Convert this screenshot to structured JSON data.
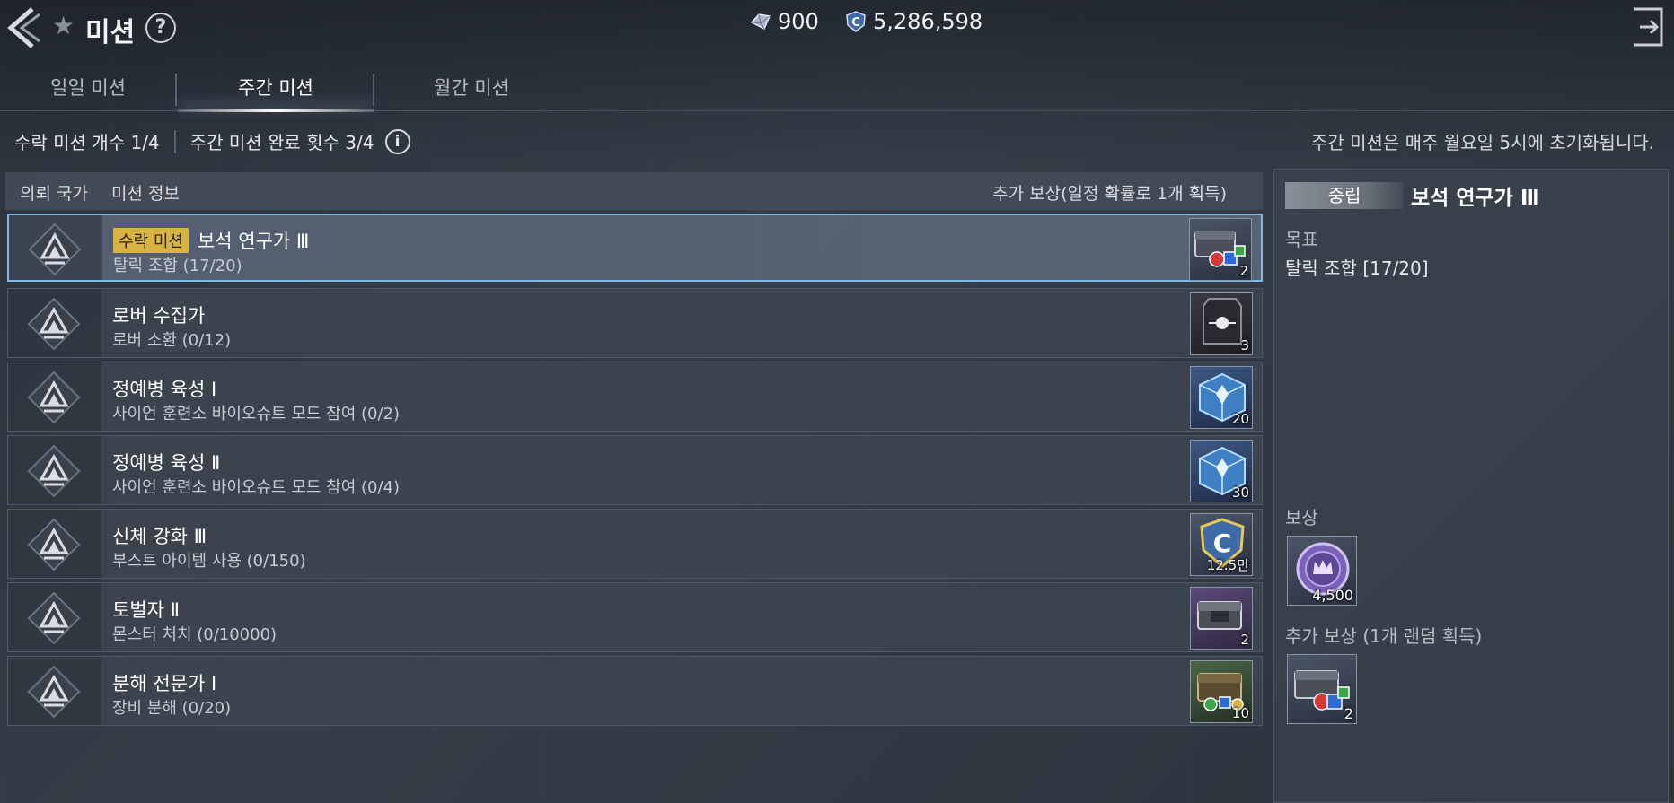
{
  "header": {
    "title": "미션",
    "help_label": "?",
    "gems": "900",
    "credits": "5,286,598"
  },
  "tabs": [
    {
      "label": "일일 미션",
      "active": false
    },
    {
      "label": "주간 미션",
      "active": true
    },
    {
      "label": "월간 미션",
      "active": false
    }
  ],
  "info": {
    "accepted_count": "수락 미션 개수 1/4",
    "weekly_completed": "주간 미션 완료 횟수 3/4",
    "info_icon": "i",
    "reset_note": "주간 미션은 매주 월요일 5시에 초기화됩니다."
  },
  "list_header": {
    "nation": "의뢰 국가",
    "mission_info": "미션 정보",
    "extra_reward": "추가 보상(일정 확률로 1개 획득)"
  },
  "missions": [
    {
      "tag": "수락 미션",
      "title": "보석 연구가 Ⅲ",
      "desc": "탈릭 조합 (17/20)",
      "reward_icon": "chest-gems-icon",
      "reward_count": "2",
      "selected": true
    },
    {
      "tag": "",
      "title": "로버 수집가",
      "desc": "로버 소환 (0/12)",
      "reward_icon": "rover-card-icon",
      "reward_count": "3",
      "selected": false
    },
    {
      "tag": "",
      "title": "정예병 육성 Ⅰ",
      "desc": "사이언 훈련소 바이오슈트 모드 참여 (0/2)",
      "reward_icon": "crystal-cube-icon",
      "reward_count": "20",
      "selected": false
    },
    {
      "tag": "",
      "title": "정예병 육성 Ⅱ",
      "desc": "사이언 훈련소 바이오슈트 모드 참여 (0/4)",
      "reward_icon": "crystal-cube-icon",
      "reward_count": "30",
      "selected": false
    },
    {
      "tag": "",
      "title": "신체 강화 Ⅲ",
      "desc": "부스트 아이템 사용 (0/150)",
      "reward_icon": "credit-coin-icon",
      "reward_count": "12.5만",
      "selected": false
    },
    {
      "tag": "",
      "title": "토벌자 Ⅱ",
      "desc": "몬스터 처치 (0/10000)",
      "reward_icon": "chest-purple-icon",
      "reward_count": "2",
      "selected": false
    },
    {
      "tag": "",
      "title": "분해 전문가 Ⅰ",
      "desc": "장비 분해 (0/20)",
      "reward_icon": "chest-green-icon",
      "reward_count": "10",
      "selected": false
    }
  ],
  "detail": {
    "faction": "중립",
    "title": "보석 연구가 Ⅲ",
    "goal_label": "목표",
    "goal_value": "탈릭 조합 [17/20]",
    "reward_label": "보상",
    "reward_icon": "crown-coin-icon",
    "reward_count": "4,500",
    "extra_reward_label": "추가 보상 (1개 랜덤 획득)",
    "extra_reward_icon": "chest-gems-icon",
    "extra_reward_count": "2"
  },
  "colors": {
    "accepted_tag": "#d9b341",
    "selected_border": "#7eb8e8"
  }
}
